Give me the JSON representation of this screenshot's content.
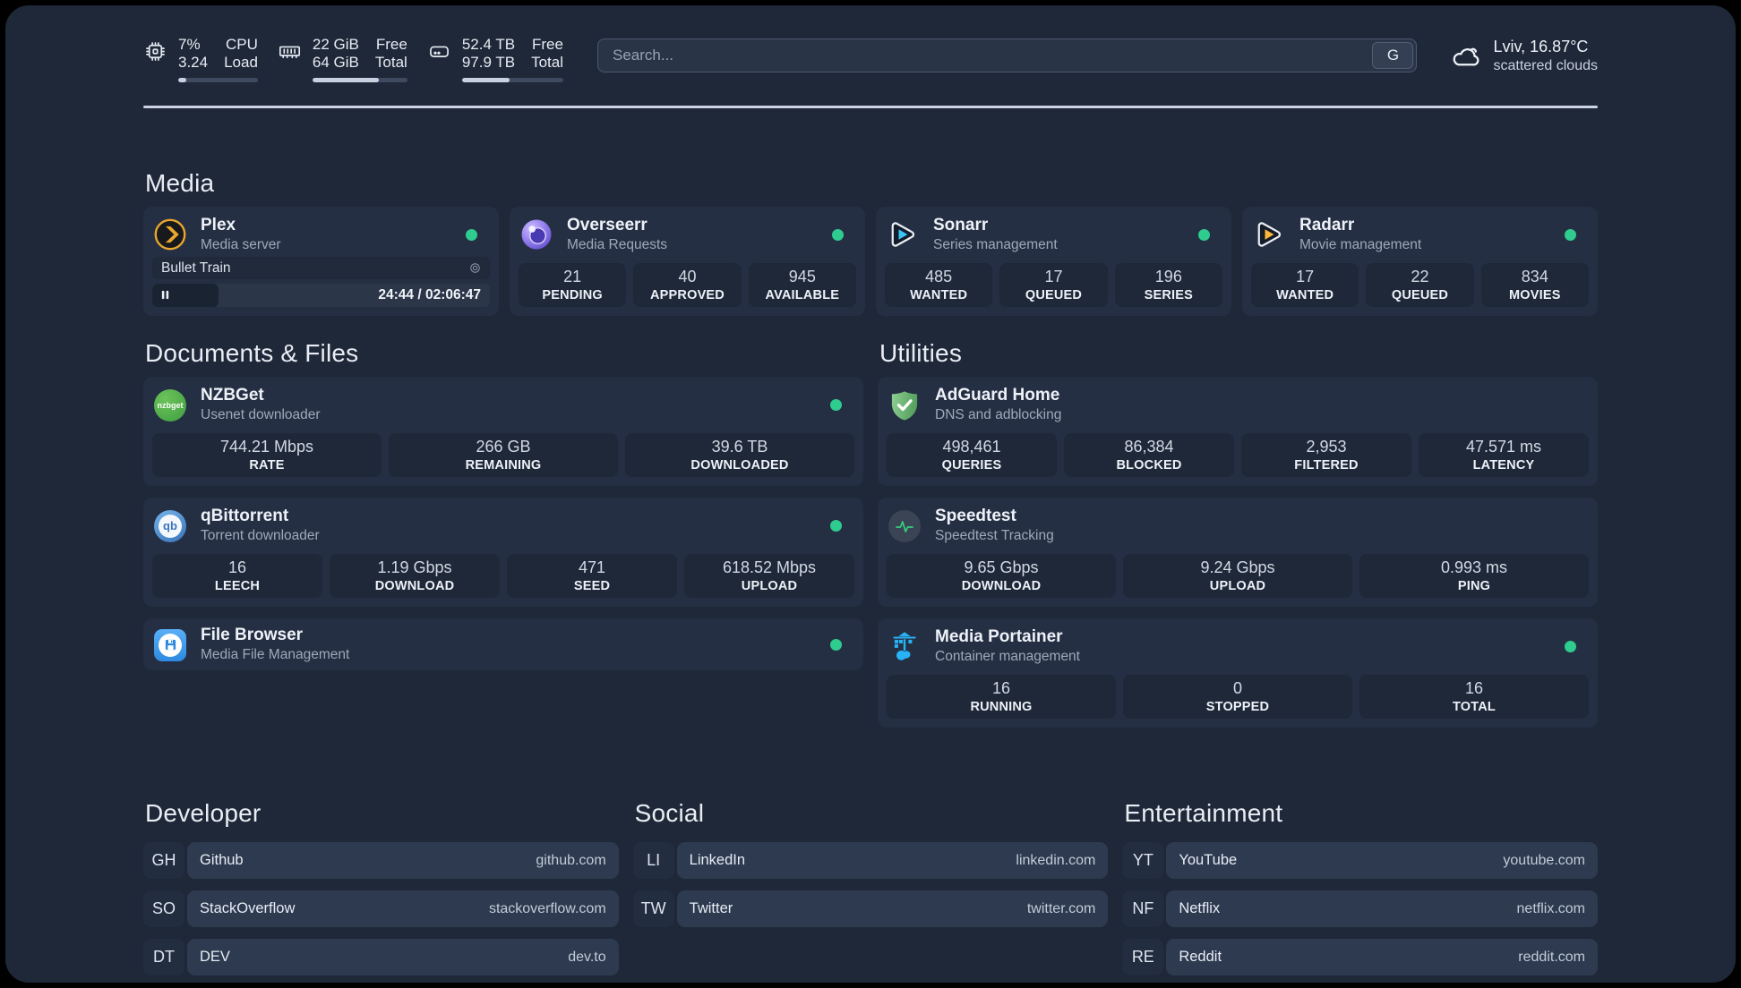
{
  "colors": {
    "background": "#1f2838",
    "card": "#252f43",
    "stat_box": "#1e2838",
    "status_online": "#2ecc8e",
    "divider": "#ccd4e1",
    "plex": "#e9a62e",
    "overseerr": "#8671ea",
    "sonarr": "#38c6f4",
    "radarr": "#ffb73a",
    "nzbget": "#4caf50",
    "qbittorrent": "#3b74bd",
    "filebrowser": "#2e8ae1",
    "adguard": "#67b279",
    "speedtest_pulse": "#35d07f",
    "portainer": "#27b3f5"
  },
  "icons": {
    "cpu": "chip",
    "ram": "memory-stick",
    "disk": "hard-drive",
    "weather": "cloud",
    "plex": "chevron-right-circle",
    "overseerr": "eye-circle",
    "sonarr": "play-triangle",
    "radarr": "play-triangle",
    "nzbget": "green-circle-wordmark",
    "qbittorrent": "qb-monogram",
    "filebrowser": "floppy-disk",
    "adguard": "shield-check",
    "speedtest": "pulse-line",
    "portainer": "crane-containers",
    "plex_session": "record-circle",
    "plex_state": "pause"
  },
  "topbar": {
    "cpu": {
      "value_top": "7%",
      "value_bottom": "3.24",
      "label_top": "CPU",
      "label_bottom": "Load",
      "progress_pct": 10
    },
    "ram": {
      "value_top": "22 GiB",
      "value_bottom": "64 GiB",
      "label_top": "Free",
      "label_bottom": "Total",
      "progress_pct": 70
    },
    "disk": {
      "value_top": "52.4 TB",
      "value_bottom": "97.9 TB",
      "label_top": "Free",
      "label_bottom": "Total",
      "progress_pct": 47
    },
    "search": {
      "placeholder": "Search...",
      "button_label": "G"
    },
    "weather": {
      "location_temp": "Lviv, 16.87°C",
      "condition": "scattered clouds"
    }
  },
  "media": {
    "title": "Media",
    "plex": {
      "name": "Plex",
      "desc": "Media server",
      "now_playing": "Bullet Train",
      "time": "24:44 / 02:06:47",
      "progress_pct": 19.5
    },
    "overseerr": {
      "name": "Overseerr",
      "desc": "Media Requests",
      "stats": [
        {
          "value": "21",
          "label": "PENDING"
        },
        {
          "value": "40",
          "label": "APPROVED"
        },
        {
          "value": "945",
          "label": "AVAILABLE"
        }
      ]
    },
    "sonarr": {
      "name": "Sonarr",
      "desc": "Series management",
      "stats": [
        {
          "value": "485",
          "label": "WANTED"
        },
        {
          "value": "17",
          "label": "QUEUED"
        },
        {
          "value": "196",
          "label": "SERIES"
        }
      ]
    },
    "radarr": {
      "name": "Radarr",
      "desc": "Movie management",
      "stats": [
        {
          "value": "17",
          "label": "WANTED"
        },
        {
          "value": "22",
          "label": "QUEUED"
        },
        {
          "value": "834",
          "label": "MOVIES"
        }
      ]
    }
  },
  "documents": {
    "title": "Documents & Files",
    "nzbget": {
      "name": "NZBGet",
      "desc": "Usenet downloader",
      "logo_text": "nzbget",
      "stats": [
        {
          "value": "744.21 Mbps",
          "label": "RATE"
        },
        {
          "value": "266 GB",
          "label": "REMAINING"
        },
        {
          "value": "39.6 TB",
          "label": "DOWNLOADED"
        }
      ]
    },
    "qbittorrent": {
      "name": "qBittorrent",
      "desc": "Torrent downloader",
      "logo_text": "qb",
      "stats": [
        {
          "value": "16",
          "label": "LEECH"
        },
        {
          "value": "1.19 Gbps",
          "label": "DOWNLOAD"
        },
        {
          "value": "471",
          "label": "SEED"
        },
        {
          "value": "618.52 Mbps",
          "label": "UPLOAD"
        }
      ]
    },
    "filebrowser": {
      "name": "File Browser",
      "desc": "Media File Management"
    }
  },
  "utilities": {
    "title": "Utilities",
    "adguard": {
      "name": "AdGuard Home",
      "desc": "DNS and adblocking",
      "stats": [
        {
          "value": "498,461",
          "label": "QUERIES"
        },
        {
          "value": "86,384",
          "label": "BLOCKED"
        },
        {
          "value": "2,953",
          "label": "FILTERED"
        },
        {
          "value": "47.571 ms",
          "label": "LATENCY"
        }
      ]
    },
    "speedtest": {
      "name": "Speedtest",
      "desc": "Speedtest Tracking",
      "stats": [
        {
          "value": "9.65 Gbps",
          "label": "DOWNLOAD"
        },
        {
          "value": "9.24 Gbps",
          "label": "UPLOAD"
        },
        {
          "value": "0.993 ms",
          "label": "PING"
        }
      ]
    },
    "portainer": {
      "name": "Media Portainer",
      "desc": "Container management",
      "stats": [
        {
          "value": "16",
          "label": "RUNNING"
        },
        {
          "value": "0",
          "label": "STOPPED"
        },
        {
          "value": "16",
          "label": "TOTAL"
        }
      ]
    }
  },
  "bookmarks": {
    "developer": {
      "title": "Developer",
      "links": [
        {
          "abbr": "GH",
          "name": "Github",
          "url": "github.com"
        },
        {
          "abbr": "SO",
          "name": "StackOverflow",
          "url": "stackoverflow.com"
        },
        {
          "abbr": "DT",
          "name": "DEV",
          "url": "dev.to"
        }
      ]
    },
    "social": {
      "title": "Social",
      "links": [
        {
          "abbr": "LI",
          "name": "LinkedIn",
          "url": "linkedin.com"
        },
        {
          "abbr": "TW",
          "name": "Twitter",
          "url": "twitter.com"
        }
      ]
    },
    "entertainment": {
      "title": "Entertainment",
      "links": [
        {
          "abbr": "YT",
          "name": "YouTube",
          "url": "youtube.com"
        },
        {
          "abbr": "NF",
          "name": "Netflix",
          "url": "netflix.com"
        },
        {
          "abbr": "RE",
          "name": "Reddit",
          "url": "reddit.com"
        }
      ]
    }
  }
}
